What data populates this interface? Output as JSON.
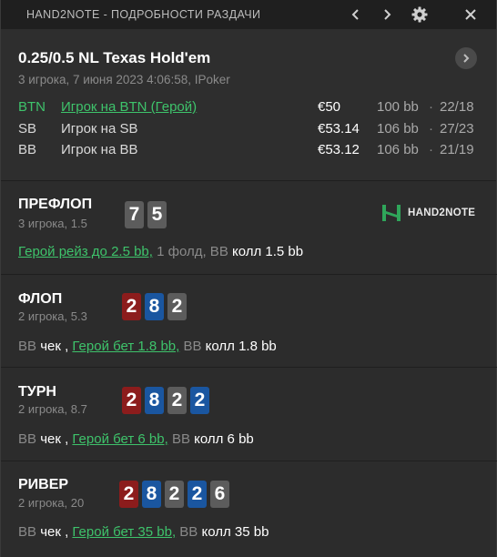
{
  "titlebar": {
    "title": "HAND2NOTE - ПОДРОБНОСТИ РАЗДАЧИ"
  },
  "hand": {
    "game": "0.25/0.5 NL Texas Hold'em",
    "sub": "3 игрока, 7 июня 2023 4:06:58, IPoker",
    "players": [
      {
        "pos": "BTN",
        "name": "Игрок на BTN (Герой)",
        "stack": "€50",
        "bb": "100 bb",
        "stat": "22/18"
      },
      {
        "pos": "SB",
        "name": "Игрок на SB",
        "stack": "€53.14",
        "bb": "106 bb",
        "stat": "27/23"
      },
      {
        "pos": "BB",
        "name": "Игрок на BB",
        "stack": "€53.12",
        "bb": "106 bb",
        "stat": "21/19"
      }
    ],
    "stat_separator": "·"
  },
  "logo": {
    "text": "HAND2NOTE"
  },
  "streets": {
    "preflop": {
      "name": "ПРЕФЛОП",
      "sub": "3 игрока, 1.5",
      "cards": [
        "7",
        "5"
      ],
      "actions": {
        "a1": "Герой рейз до 2.5 bb,",
        "a2": " 1 фолд, BB ",
        "a3": "колл 1.5 bb"
      }
    },
    "flop": {
      "name": "ФЛОП",
      "sub": "2 игрока, 5.3",
      "cards": [
        "2",
        "8",
        "2"
      ],
      "actions": {
        "p1": "BB ",
        "v1": "чек ,",
        "sp": " ",
        "hero": "Герой бет 1.8 bb,",
        "p2": " BB ",
        "v2": "колл 1.8 bb"
      }
    },
    "turn": {
      "name": "ТУРН",
      "sub": "2 игрока, 8.7",
      "cards": [
        "2",
        "8",
        "2",
        "2"
      ],
      "actions": {
        "p1": "BB ",
        "v1": "чек ,",
        "sp": " ",
        "hero": "Герой бет 6 bb,",
        "p2": " BB ",
        "v2": "колл 6 bb"
      }
    },
    "river": {
      "name": "РИВЕР",
      "sub": "2 игрока, 20",
      "cards": [
        "2",
        "8",
        "2",
        "2",
        "6"
      ],
      "actions": {
        "p1": "BB ",
        "v1": "чек ,",
        "sp": " ",
        "hero": "Герой бет 35 bb,",
        "p2": " BB ",
        "v2": "колл 35 bb"
      }
    }
  },
  "colors": {
    "hero_green": "#3ec36b",
    "card_red": "#8c1c1c",
    "card_blue": "#1a56a0",
    "card_gray": "#5c5c5c"
  },
  "icons": [
    "chevron-left-icon",
    "chevron-right-icon",
    "gear-icon",
    "close-icon",
    "next-hand-icon",
    "hand2note-logo-icon"
  ]
}
